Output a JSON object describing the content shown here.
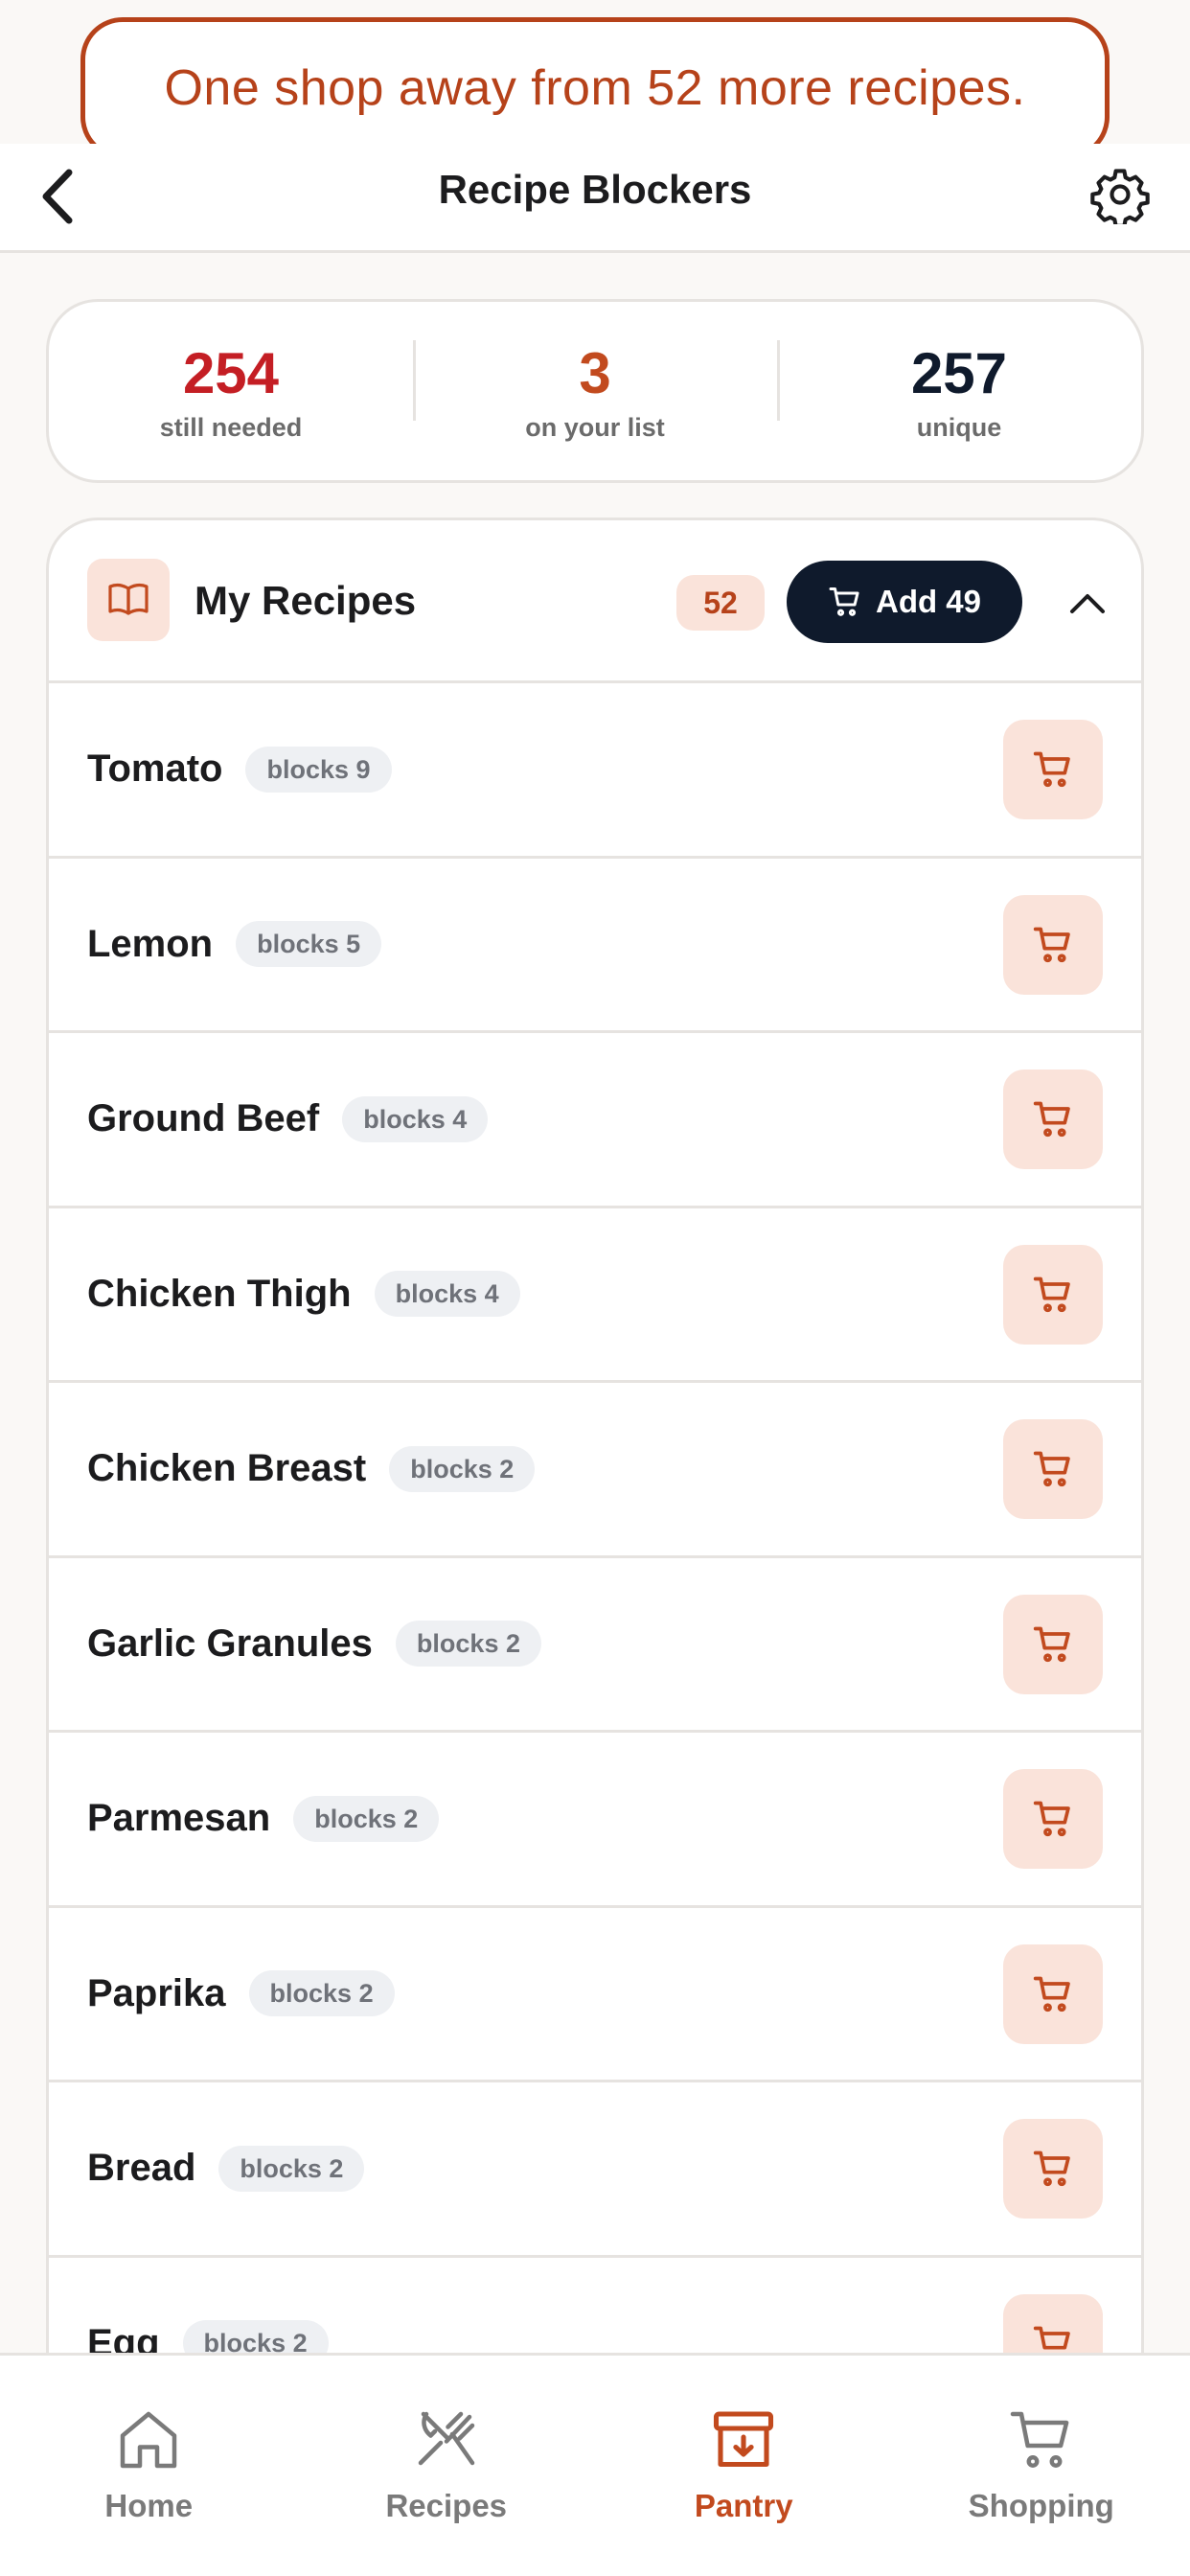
{
  "banner": {
    "text": "One shop away from 52 more recipes."
  },
  "header": {
    "title": "Recipe Blockers"
  },
  "stats": [
    {
      "value": "254",
      "label": "still needed",
      "color": "#c41e24"
    },
    {
      "value": "3",
      "label": "on your list",
      "color": "#c24a1e"
    },
    {
      "value": "257",
      "label": "unique",
      "color": "#0f1a2c"
    }
  ],
  "section": {
    "title": "My Recipes",
    "count": "52",
    "add_label": "Add 49",
    "items": [
      {
        "name": "Tomato",
        "badge": "blocks 9"
      },
      {
        "name": "Lemon",
        "badge": "blocks 5"
      },
      {
        "name": "Ground Beef",
        "badge": "blocks 4"
      },
      {
        "name": "Chicken Thigh",
        "badge": "blocks 4"
      },
      {
        "name": "Chicken Breast",
        "badge": "blocks 2"
      },
      {
        "name": "Garlic Granules",
        "badge": "blocks 2"
      },
      {
        "name": "Parmesan",
        "badge": "blocks 2"
      },
      {
        "name": "Paprika",
        "badge": "blocks 2"
      },
      {
        "name": "Bread",
        "badge": "blocks 2"
      },
      {
        "name": "Egg",
        "badge": "blocks 2"
      }
    ]
  },
  "tabs": [
    {
      "label": "Home",
      "icon": "home-icon",
      "active": false
    },
    {
      "label": "Recipes",
      "icon": "utensils-icon",
      "active": false
    },
    {
      "label": "Pantry",
      "icon": "pantry-box-icon",
      "active": true
    },
    {
      "label": "Shopping",
      "icon": "shopping-cart-icon",
      "active": false
    }
  ],
  "colors": {
    "accent": "#c24a1e",
    "banner_border": "#b6421a",
    "dark": "#0f1a2c",
    "soft_accent_bg": "#fae3da"
  }
}
